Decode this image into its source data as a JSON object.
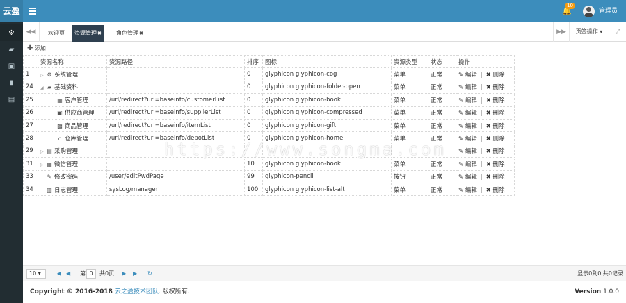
{
  "app": {
    "brand": "云盈",
    "user_name": "管理员",
    "notification_count": "10"
  },
  "tabs": {
    "nav_prev": "◀◀",
    "nav_next": "▶▶",
    "items": [
      {
        "label": "欢迎页"
      },
      {
        "label": "资源管理"
      },
      {
        "label": "角色管理"
      }
    ],
    "page_ops_label": "页签操作 ▾",
    "fullscreen": "⤢"
  },
  "toolbar": {
    "add_label": "添加"
  },
  "table": {
    "columns": [
      "资源名称",
      "资源路径",
      "排序",
      "图标",
      "资源类型",
      "状态",
      "操作"
    ],
    "rows": [
      {
        "id": "1",
        "arrow": "▷",
        "icon": "cog-icon",
        "name": "系统管理",
        "path": "",
        "sort": "0",
        "icon_class": "glyphicon glyphicon-cog",
        "type": "菜单",
        "state": "正常"
      },
      {
        "id": "24",
        "arrow": "◢",
        "icon": "folder-open-icon",
        "name": "基础资料",
        "path": "",
        "sort": "0",
        "icon_class": "glyphicon glyphicon-folder-open",
        "type": "菜单",
        "state": "正常"
      },
      {
        "id": "25",
        "arrow": "",
        "icon": "book-icon",
        "name": "客户管理",
        "path": "/url/redirect?url=baseinfo/customerList",
        "sort": "0",
        "icon_class": "glyphicon glyphicon-book",
        "type": "菜单",
        "state": "正常"
      },
      {
        "id": "26",
        "arrow": "",
        "icon": "compressed-icon",
        "name": "供应商管理",
        "path": "/url/redirect?url=baseinfo/supplierList",
        "sort": "0",
        "icon_class": "glyphicon glyphicon-compressed",
        "type": "菜单",
        "state": "正常"
      },
      {
        "id": "27",
        "arrow": "",
        "icon": "gift-icon",
        "name": "商品管理",
        "path": "/url/redirect?url=baseinfo/itemList",
        "sort": "0",
        "icon_class": "glyphicon glyphicon-gift",
        "type": "菜单",
        "state": "正常"
      },
      {
        "id": "28",
        "arrow": "",
        "icon": "home-icon",
        "name": "仓库管理",
        "path": "/url/redirect?url=baseinfo/depotList",
        "sort": "0",
        "icon_class": "glyphicon glyphicon-home",
        "type": "菜单",
        "state": "正常"
      },
      {
        "id": "29",
        "arrow": "▷",
        "icon": "briefcase-icon",
        "name": "采购管理",
        "path": "",
        "sort": "",
        "icon_class": "",
        "type": "",
        "state": ""
      },
      {
        "id": "31",
        "arrow": "▷",
        "icon": "book-icon",
        "name": "微信管理",
        "path": "",
        "sort": "10",
        "icon_class": "glyphicon glyphicon-book",
        "type": "菜单",
        "state": "正常"
      },
      {
        "id": "33",
        "arrow": "",
        "icon": "pencil-icon",
        "name": "修改密码",
        "path": "/user/editPwdPage",
        "sort": "99",
        "icon_class": "glyphicon-pencil",
        "type": "按钮",
        "state": "正常"
      },
      {
        "id": "34",
        "arrow": "",
        "icon": "list-alt-icon",
        "name": "日志管理",
        "path": "sysLog/manager",
        "sort": "100",
        "icon_class": "glyphicon glyphicon-list-alt",
        "type": "菜单",
        "state": "正常"
      }
    ],
    "edit_label": "编辑",
    "delete_label": "删除"
  },
  "watermark": "https://www.songma.com",
  "pager": {
    "page_size": "10 ▾",
    "label_pre": "第",
    "current_page": "0",
    "label_total": "共0页",
    "info": "显示0到0,共0记录"
  },
  "footer": {
    "copyright_prefix": "Copyright © 2016-2018 ",
    "team": "云之盈技术团队",
    "copyright_suffix": ". 版权所有.",
    "version_label": "Version",
    "version": "1.0.0"
  },
  "colors": {
    "header": "#3c8dbc",
    "sidebar": "#222d32",
    "active_tab": "#2f4050",
    "badge": "#f39c12"
  }
}
